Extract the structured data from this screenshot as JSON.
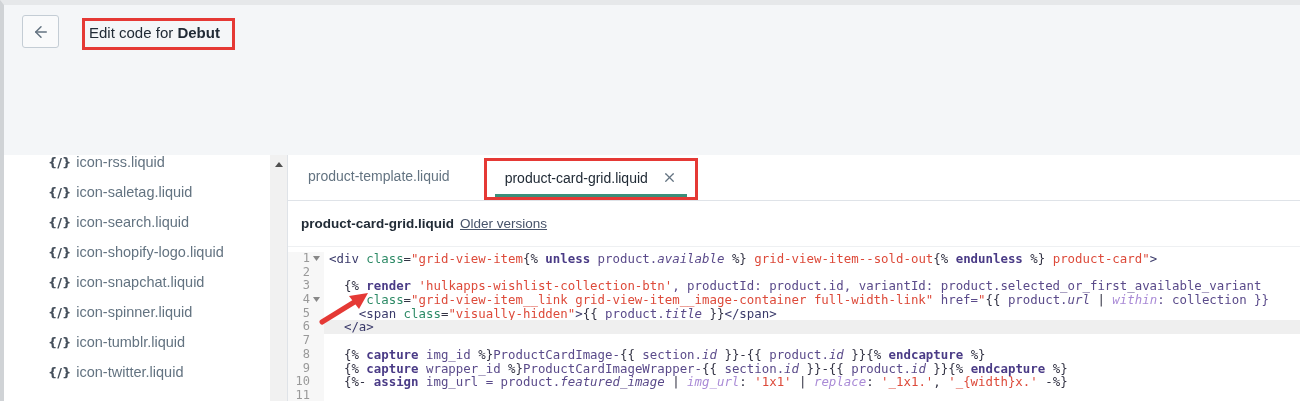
{
  "header": {
    "title_prefix": "Edit code for",
    "theme_name": "Debut"
  },
  "sidebar": {
    "items": [
      {
        "icon": "{/}",
        "label": "icon-rss.liquid"
      },
      {
        "icon": "{/}",
        "label": "icon-saletag.liquid"
      },
      {
        "icon": "{/}",
        "label": "icon-search.liquid"
      },
      {
        "icon": "{/}",
        "label": "icon-shopify-logo.liquid"
      },
      {
        "icon": "{/}",
        "label": "icon-snapchat.liquid"
      },
      {
        "icon": "{/}",
        "label": "icon-spinner.liquid"
      },
      {
        "icon": "{/}",
        "label": "icon-tumblr.liquid"
      },
      {
        "icon": "{/}",
        "label": "icon-twitter.liquid"
      }
    ]
  },
  "tabs": [
    {
      "label": "product-template.liquid",
      "selected": false
    },
    {
      "label": "product-card-grid.liquid",
      "selected": true
    }
  ],
  "file_header": {
    "file_name": "product-card-grid.liquid",
    "link": "Older versions"
  },
  "code": [
    {
      "number": "1",
      "fold": true,
      "active": false,
      "tokens": [
        {
          "kind": "tag",
          "text": "<div"
        },
        {
          "kind": "attr",
          "text": " class"
        },
        {
          "kind": "plain",
          "text": "="
        },
        {
          "kind": "string",
          "text": "\"grid-view-item"
        },
        {
          "kind": "plain",
          "text": "{%"
        },
        {
          "kind": "keyword",
          "text": " unless "
        },
        {
          "kind": "var",
          "text": "product."
        },
        {
          "kind": "prop",
          "text": "available"
        },
        {
          "kind": "plain",
          "text": " %}"
        },
        {
          "kind": "string",
          "text": " grid-view-item--sold-out"
        },
        {
          "kind": "plain",
          "text": "{%"
        },
        {
          "kind": "keyword",
          "text": " endunless "
        },
        {
          "kind": "plain",
          "text": "%}"
        },
        {
          "kind": "string",
          "text": " product-card\""
        },
        {
          "kind": "tag",
          "text": ">"
        }
      ]
    },
    {
      "number": "2",
      "fold": false,
      "active": false
    },
    {
      "number": "3",
      "fold": false,
      "active": false,
      "tokens": [
        {
          "kind": "plain",
          "text": "  {% "
        },
        {
          "kind": "keyword",
          "text": "render"
        },
        {
          "kind": "string",
          "text": " 'hulkapps-wishlist-collection-btn'"
        },
        {
          "kind": "var",
          "text": ", productId: product.id, variantId: product.selected_or_first_available_variant"
        }
      ]
    },
    {
      "number": "4",
      "fold": true,
      "active": false,
      "tokens": [
        {
          "kind": "attr",
          "text": "     class"
        },
        {
          "kind": "plain",
          "text": "="
        },
        {
          "kind": "string",
          "text": "\"grid-view-item__link grid-view-item__image-container full-width-link\""
        },
        {
          "kind": "var",
          "text": " href="
        },
        {
          "kind": "string",
          "text": "\""
        },
        {
          "kind": "plain",
          "text": "{{ "
        },
        {
          "kind": "var",
          "text": "product."
        },
        {
          "kind": "prop",
          "text": "url"
        },
        {
          "kind": "plain",
          "text": " | "
        },
        {
          "kind": "filter",
          "text": "within"
        },
        {
          "kind": "var",
          "text": ": collection }}"
        }
      ]
    },
    {
      "number": "5",
      "fold": false,
      "active": false,
      "tokens": [
        {
          "kind": "tag",
          "text": "    <span"
        },
        {
          "kind": "attr",
          "text": " class"
        },
        {
          "kind": "plain",
          "text": "="
        },
        {
          "kind": "string",
          "text": "\"visually-hidden\""
        },
        {
          "kind": "tag",
          "text": ">"
        },
        {
          "kind": "plain",
          "text": "{{ "
        },
        {
          "kind": "var",
          "text": "product."
        },
        {
          "kind": "prop",
          "text": "title"
        },
        {
          "kind": "plain",
          "text": " }}"
        },
        {
          "kind": "tag",
          "text": "</span>"
        }
      ]
    },
    {
      "number": "6",
      "fold": false,
      "active": true,
      "tokens": [
        {
          "kind": "tag",
          "text": "  </a>"
        }
      ]
    },
    {
      "number": "7",
      "fold": false,
      "active": false
    },
    {
      "number": "8",
      "fold": false,
      "active": false,
      "tokens": [
        {
          "kind": "plain",
          "text": "  {% "
        },
        {
          "kind": "keyword",
          "text": "capture"
        },
        {
          "kind": "var",
          "text": " img_id "
        },
        {
          "kind": "plain",
          "text": "%}"
        },
        {
          "kind": "var",
          "text": "ProductCardImage-"
        },
        {
          "kind": "plain",
          "text": "{{ "
        },
        {
          "kind": "var",
          "text": "section."
        },
        {
          "kind": "prop",
          "text": "id"
        },
        {
          "kind": "plain",
          "text": " }}-{{ "
        },
        {
          "kind": "var",
          "text": "product."
        },
        {
          "kind": "prop",
          "text": "id"
        },
        {
          "kind": "plain",
          "text": " }}{% "
        },
        {
          "kind": "keyword",
          "text": "endcapture"
        },
        {
          "kind": "plain",
          "text": " %}"
        }
      ]
    },
    {
      "number": "9",
      "fold": false,
      "active": false,
      "tokens": [
        {
          "kind": "plain",
          "text": "  {% "
        },
        {
          "kind": "keyword",
          "text": "capture"
        },
        {
          "kind": "var",
          "text": " wrapper_id "
        },
        {
          "kind": "plain",
          "text": "%}"
        },
        {
          "kind": "var",
          "text": "ProductCardImageWrapper-"
        },
        {
          "kind": "plain",
          "text": "{{ "
        },
        {
          "kind": "var",
          "text": "section."
        },
        {
          "kind": "prop",
          "text": "id"
        },
        {
          "kind": "plain",
          "text": " }}-{{ "
        },
        {
          "kind": "var",
          "text": "product."
        },
        {
          "kind": "prop",
          "text": "id"
        },
        {
          "kind": "plain",
          "text": " }}{% "
        },
        {
          "kind": "keyword",
          "text": "endcapture"
        },
        {
          "kind": "plain",
          "text": " %}"
        }
      ]
    },
    {
      "number": "10",
      "fold": false,
      "active": false,
      "tokens": [
        {
          "kind": "plain",
          "text": "  {%- "
        },
        {
          "kind": "keyword",
          "text": "assign"
        },
        {
          "kind": "var",
          "text": " img_url = product."
        },
        {
          "kind": "prop",
          "text": "featured_image"
        },
        {
          "kind": "plain",
          "text": " | "
        },
        {
          "kind": "filter",
          "text": "img_url"
        },
        {
          "kind": "plain",
          "text": ": "
        },
        {
          "kind": "string",
          "text": "'1x1'"
        },
        {
          "kind": "plain",
          "text": " | "
        },
        {
          "kind": "filter",
          "text": "replace"
        },
        {
          "kind": "plain",
          "text": ": "
        },
        {
          "kind": "string",
          "text": "'_1x1.'"
        },
        {
          "kind": "plain",
          "text": ", "
        },
        {
          "kind": "string",
          "text": "'_{width}x.'"
        },
        {
          "kind": "plain",
          "text": " -%}"
        }
      ]
    },
    {
      "number": "11",
      "fold": false,
      "active": false
    }
  ]
}
